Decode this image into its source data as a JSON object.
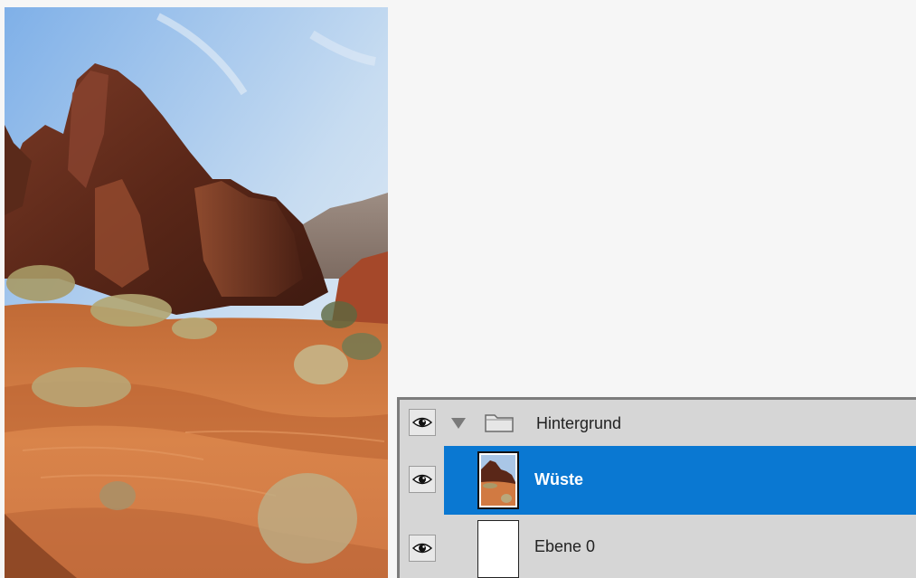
{
  "document": {
    "image_subject": "desert-rock-landscape"
  },
  "layers_panel": {
    "rows": [
      {
        "name": "Hintergrund",
        "type": "group",
        "expanded": true,
        "visible": true,
        "selected": false,
        "icon": "folder-icon"
      },
      {
        "name": "Wüste",
        "type": "image",
        "visible": true,
        "selected": true
      },
      {
        "name": "Ebene 0",
        "type": "image",
        "visible": true,
        "selected": false
      }
    ],
    "colors": {
      "selection": "#0a78d2",
      "row_background": "#d6d6d6",
      "canvas_background": "#f6f6f6"
    }
  }
}
